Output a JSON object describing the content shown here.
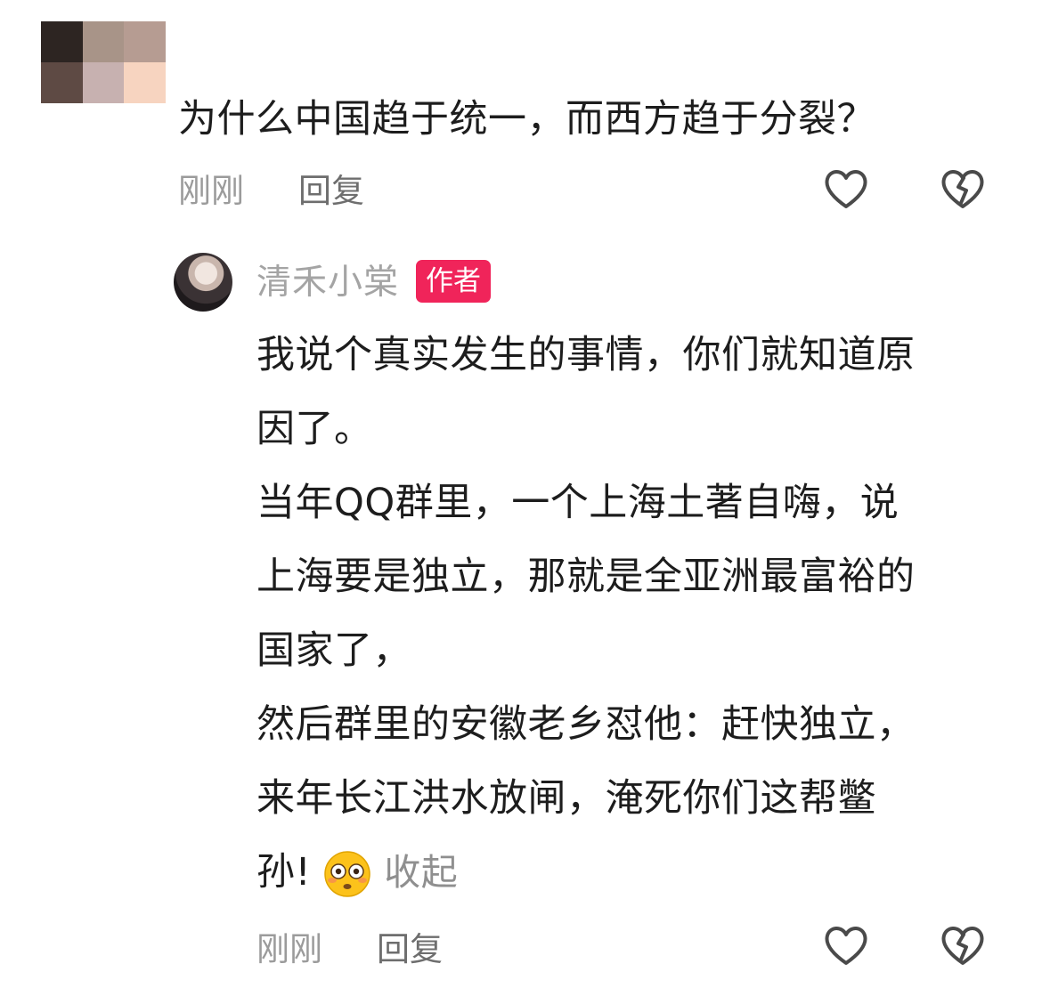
{
  "comment": {
    "question": "为什么中国趋于统一，而西方趋于分裂？",
    "time": "刚刚",
    "reply_label": "回复"
  },
  "reply": {
    "author_name": "清禾小棠",
    "author_badge": "作者",
    "lines": [
      "我说个真实发生的事情，你们就知道原",
      "因了。",
      "当年QQ群里，一个上海土著自嗨，说",
      "上海要是独立，那就是全亚洲最富裕的",
      "国家了，",
      "然后群里的安徽老乡怼他：赶快独立，",
      "来年长江洪水放闸，淹死你们这帮鳖"
    ],
    "last_line_text": "孙!",
    "emoji": "flushed-face-emoji",
    "collapse_label": "收起",
    "time": "刚刚",
    "reply_label": "回复"
  },
  "icons": {
    "like": "heart-outline-icon",
    "dislike": "broken-heart-icon"
  },
  "colors": {
    "badge": "#f0245a",
    "meta_text": "#9b9b9b",
    "body_text": "#1d1d1d"
  }
}
